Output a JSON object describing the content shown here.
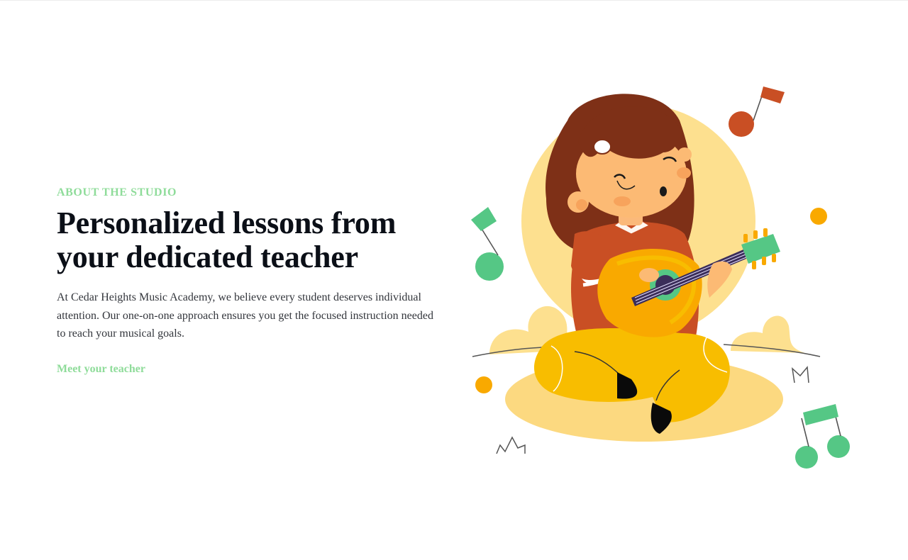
{
  "about": {
    "eyebrow": "ABOUT THE STUDIO",
    "headline": "Personalized lessons from your dedicated teacher",
    "body": "At Cedar Heights Music Academy, we believe every student deserves individual attention. Our one-on-one approach ensures you get the focused instruction needed to reach your musical goals.",
    "cta_label": "Meet your teacher"
  },
  "colors": {
    "accent_green": "#8fdc9a",
    "headline": "#0b0f17",
    "body": "#33363c",
    "illustration_yellow": "#fcd980",
    "illustration_orange": "#f9a900",
    "note_green": "#55c785",
    "note_red": "#c94f24"
  },
  "illustration": {
    "subject": "girl-playing-ukulele",
    "icons": [
      "music-note-icon",
      "flag-note-icon",
      "double-note-icon"
    ]
  }
}
